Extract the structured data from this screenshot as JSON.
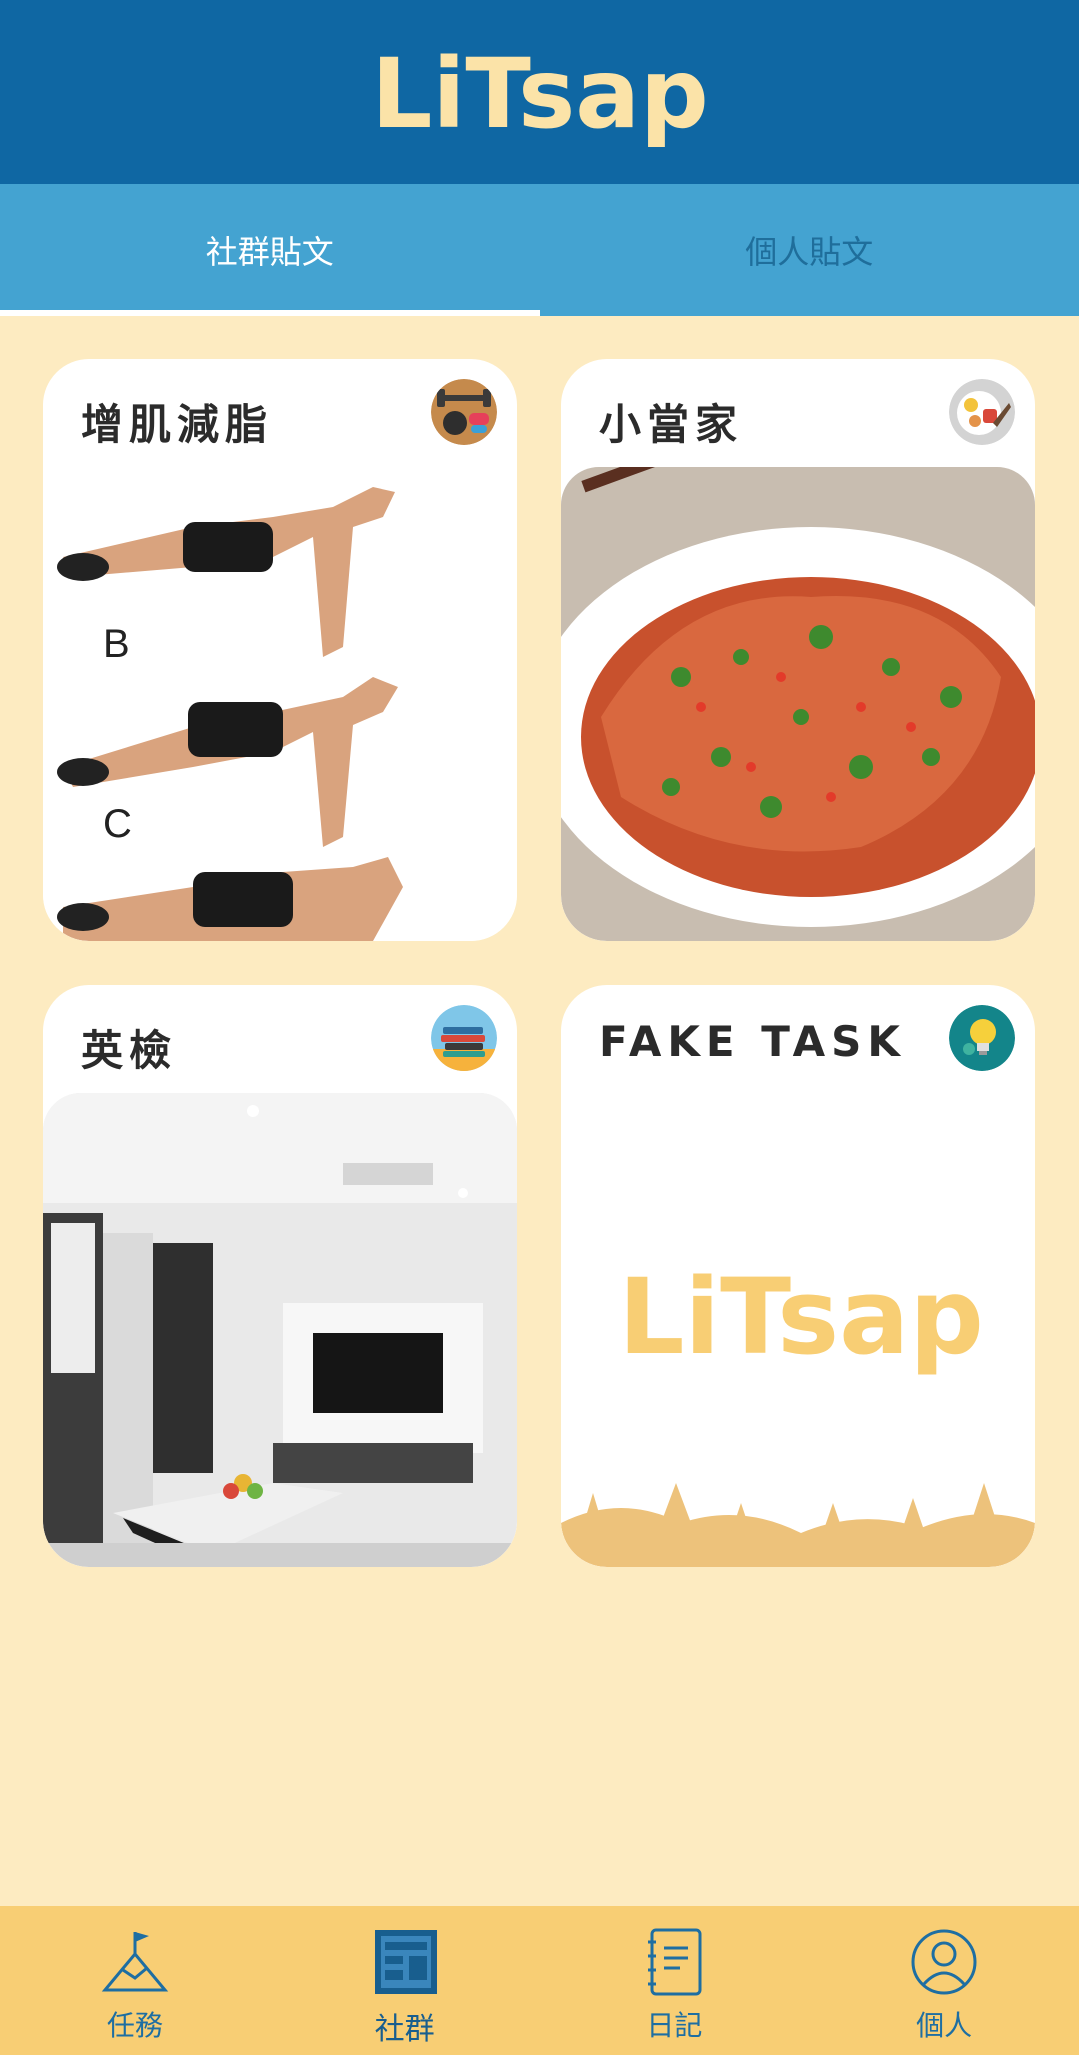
{
  "app": {
    "logo_text": "LiTsap"
  },
  "tabs": [
    {
      "label": "社群貼文",
      "active": true
    },
    {
      "label": "個人貼文",
      "active": false
    }
  ],
  "cards": [
    {
      "title": "增肌減脂",
      "icon": "fitness-icon",
      "image": "pushup-photo",
      "image_labels": [
        "B",
        "C"
      ]
    },
    {
      "title": "小當家",
      "icon": "food-icon",
      "image": "fried-chicken-photo"
    },
    {
      "title": "英檢",
      "icon": "books-icon",
      "image": "living-room-photo"
    },
    {
      "title": "FAKE TASK",
      "icon": "lightbulb-icon",
      "image": "litsap-logo-placeholder",
      "placeholder_logo_text": "LiTsap"
    }
  ],
  "bottom_nav": [
    {
      "label": "任務",
      "icon": "mountain-flag-icon",
      "active": false
    },
    {
      "label": "社群",
      "icon": "newspaper-icon",
      "active": true
    },
    {
      "label": "日記",
      "icon": "notebook-icon",
      "active": false
    },
    {
      "label": "個人",
      "icon": "user-icon",
      "active": false
    }
  ],
  "colors": {
    "header": "#0F67A3",
    "tabs": "#44A3D1",
    "background": "#FDEBC1",
    "bottom_nav": "#F8CE74",
    "nav_text": "#1E6EA2"
  }
}
